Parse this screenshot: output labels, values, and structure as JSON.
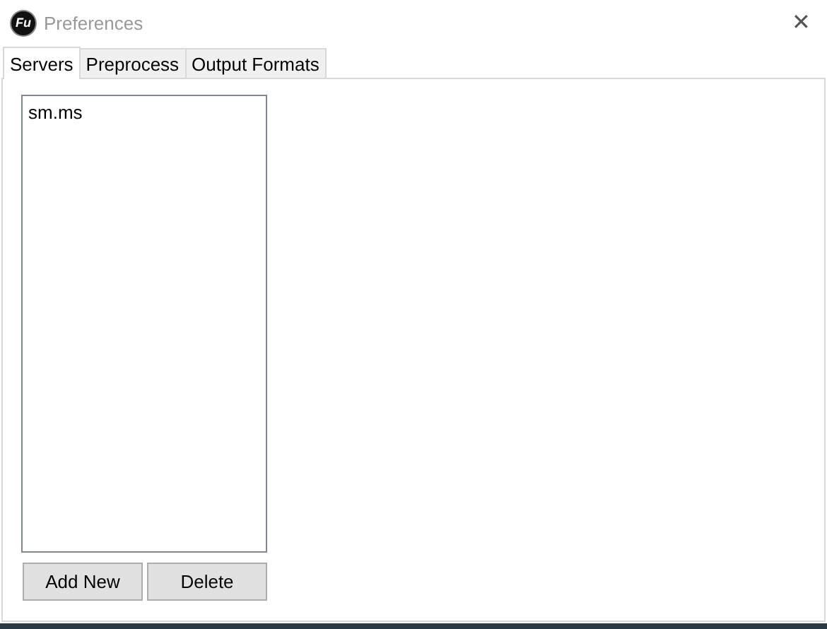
{
  "window": {
    "logo": "Fu",
    "title": "Preferences",
    "close": "✕"
  },
  "tabs": [
    {
      "label": "Servers",
      "selected": true
    },
    {
      "label": "Preprocess",
      "selected": false
    },
    {
      "label": "Output Formats",
      "selected": false
    }
  ],
  "servers": {
    "items": [
      {
        "label": "sm.ms",
        "selected": false
      }
    ]
  },
  "buttons": [
    "Add New",
    "Delete"
  ]
}
